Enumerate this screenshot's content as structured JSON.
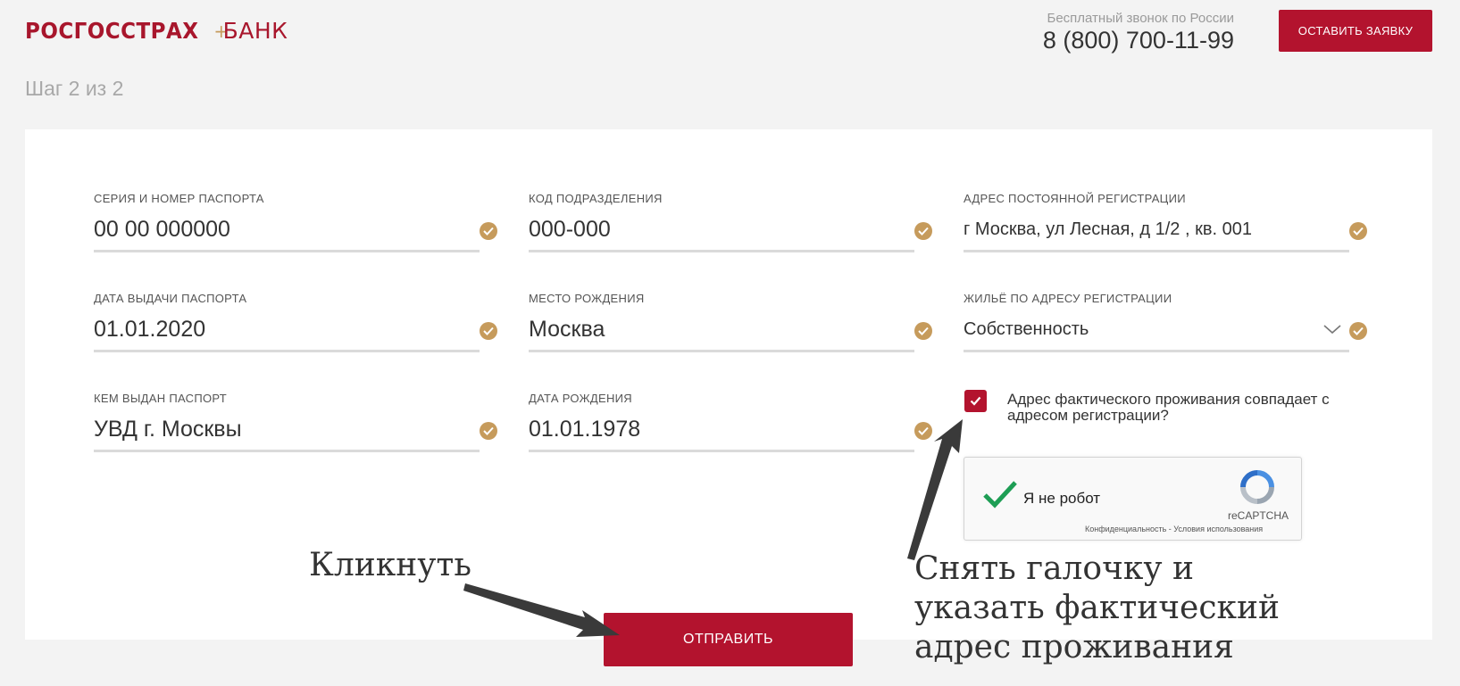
{
  "header": {
    "logo_strong": "РОСГОССТРАХ",
    "logo_plus": "+",
    "logo_light": "БАНК",
    "phone_caption": "Бесплатный звонок по России",
    "phone_number": "8 (800) 700-11-99",
    "apply_label": "ОСТАВИТЬ ЗАЯВКУ"
  },
  "step": "Шаг 2 из 2",
  "fields": [
    {
      "label": "СЕРИЯ И НОМЕР ПАСПОРТА",
      "value": "00 00 000000"
    },
    {
      "label": "КОД ПОДРАЗДЕЛЕНИЯ",
      "value": "000-000"
    },
    {
      "label": "АДРЕС ПОСТОЯННОЙ РЕГИСТРАЦИИ",
      "value": "г Москва, ул Лесная, д 1/2 , кв. 001"
    },
    {
      "label": "ДАТА ВЫДАЧИ ПАСПОРТА",
      "value": "01.01.2020"
    },
    {
      "label": "МЕСТО РОЖДЕНИЯ",
      "value": "Москва"
    },
    {
      "label": "ЖИЛЬЁ ПО АДРЕСУ РЕГИСТРАЦИИ",
      "value": "Собственность"
    },
    {
      "label": "КЕМ ВЫДАН ПАСПОРТ",
      "value": "УВД г. Москвы"
    },
    {
      "label": "ДАТА РОЖДЕНИЯ",
      "value": "01.01.1978"
    }
  ],
  "same_address": {
    "checked": true,
    "label": "Адрес фактического проживания совпадает с адресом регистрации?"
  },
  "recaptcha": {
    "label": "Я не робот",
    "brand": "reCAPTCHA",
    "links": "Конфиденциальность - Условия использования"
  },
  "submit_label": "ОТПРАВИТЬ",
  "annotations": {
    "click": "Кликнуть",
    "uncheck": "Снять галочку и указать фактический адрес проживания"
  },
  "colors": {
    "brand": "#b3132e",
    "check": "#c69b5c"
  }
}
